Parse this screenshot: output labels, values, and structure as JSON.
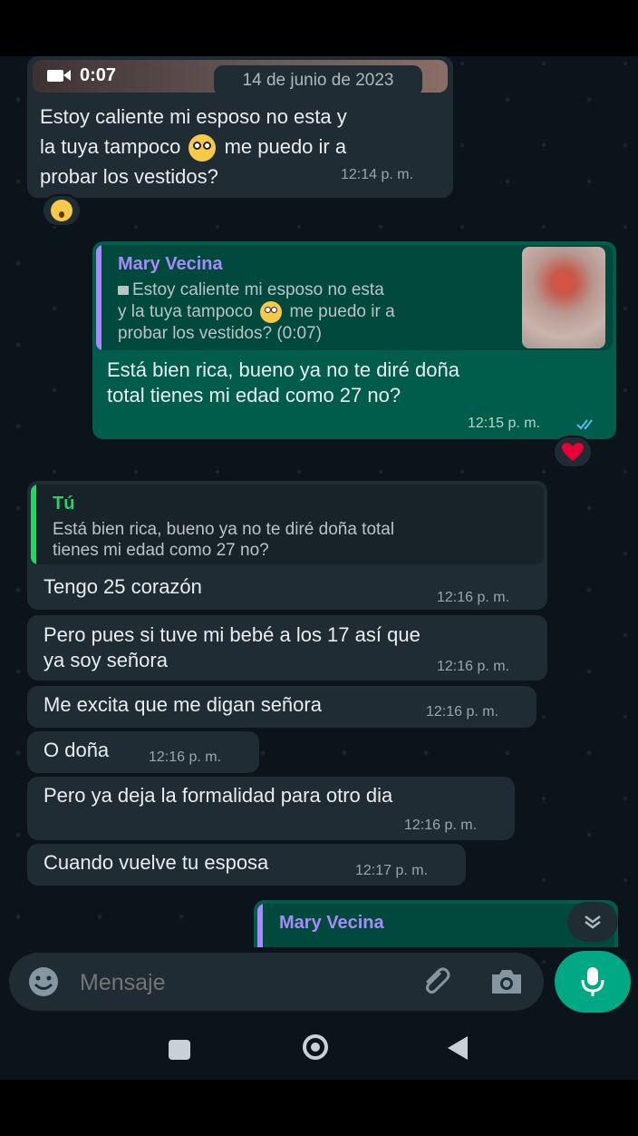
{
  "video": {
    "duration": "0:07"
  },
  "date_chip": "14 de junio de 2023",
  "messages": [
    {
      "text_parts": [
        "Estoy caliente mi esposo no esta y",
        "la tuya tampoco",
        "me puedo ir a",
        "probar los vestidos?"
      ],
      "time": "12:14 p. m."
    },
    {
      "quote_name": "Mary Vecina",
      "quote_lines": [
        "Estoy caliente mi esposo no esta",
        "y la tuya tampoco",
        "me puedo ir a",
        "probar los vestidos? (0:07)"
      ],
      "text_lines": [
        "Está bien rica, bueno ya no te diré doña",
        "total tienes mi edad como 27 no?"
      ],
      "time": "12:15 p. m."
    },
    {
      "quote_name": "Tú",
      "quote_lines": [
        "Está bien rica, bueno ya no te diré doña total",
        "tienes mi edad como 27 no?"
      ],
      "text": "Tengo 25 corazón",
      "time": "12:16 p. m."
    },
    {
      "text_lines": [
        "Pero pues si tuve mi bebé a los 17 así que",
        "ya soy señora"
      ],
      "time": "12:16 p. m."
    },
    {
      "text": "Me excita que me digan señora",
      "time": "12:16 p. m."
    },
    {
      "text": "O doña",
      "time": "12:16 p. m."
    },
    {
      "text": "Pero ya deja la formalidad para otro dia",
      "time": "12:16 p. m."
    },
    {
      "text": "Cuando vuelve tu esposa",
      "time": "12:17 p. m."
    },
    {
      "quote_name": "Mary Vecina"
    }
  ],
  "input": {
    "placeholder": "Mensaje"
  },
  "colors": {
    "background": "#0b141a",
    "incoming": "#1f2c34",
    "outgoing": "#005c4b",
    "accent": "#00a884",
    "quote_name_out": "#a78bfa",
    "quote_name_in": "#25d366"
  },
  "icons": [
    "video-icon",
    "emoji-icon",
    "attach-icon",
    "camera-icon",
    "mic-icon",
    "scroll-down-icon",
    "double-check-icon",
    "heart-icon",
    "surprised-face-icon",
    "square-nav-icon",
    "home-nav-icon",
    "back-nav-icon"
  ]
}
